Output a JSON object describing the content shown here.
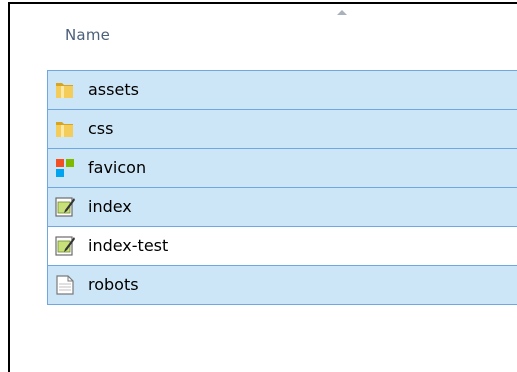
{
  "header": {
    "column_name": "Name"
  },
  "files": [
    {
      "name": "assets",
      "icon": "folder-icon",
      "selected": true
    },
    {
      "name": "css",
      "icon": "folder-icon",
      "selected": true
    },
    {
      "name": "favicon",
      "icon": "favicon-image-icon",
      "selected": true
    },
    {
      "name": "index",
      "icon": "html-document-icon",
      "selected": true
    },
    {
      "name": "index-test",
      "icon": "html-document-icon",
      "selected": false
    },
    {
      "name": "robots",
      "icon": "text-document-icon",
      "selected": true
    }
  ],
  "colors": {
    "selection_fill": "#cde6f7",
    "selection_border": "#6fa8e1",
    "header_text": "#4c607a"
  }
}
